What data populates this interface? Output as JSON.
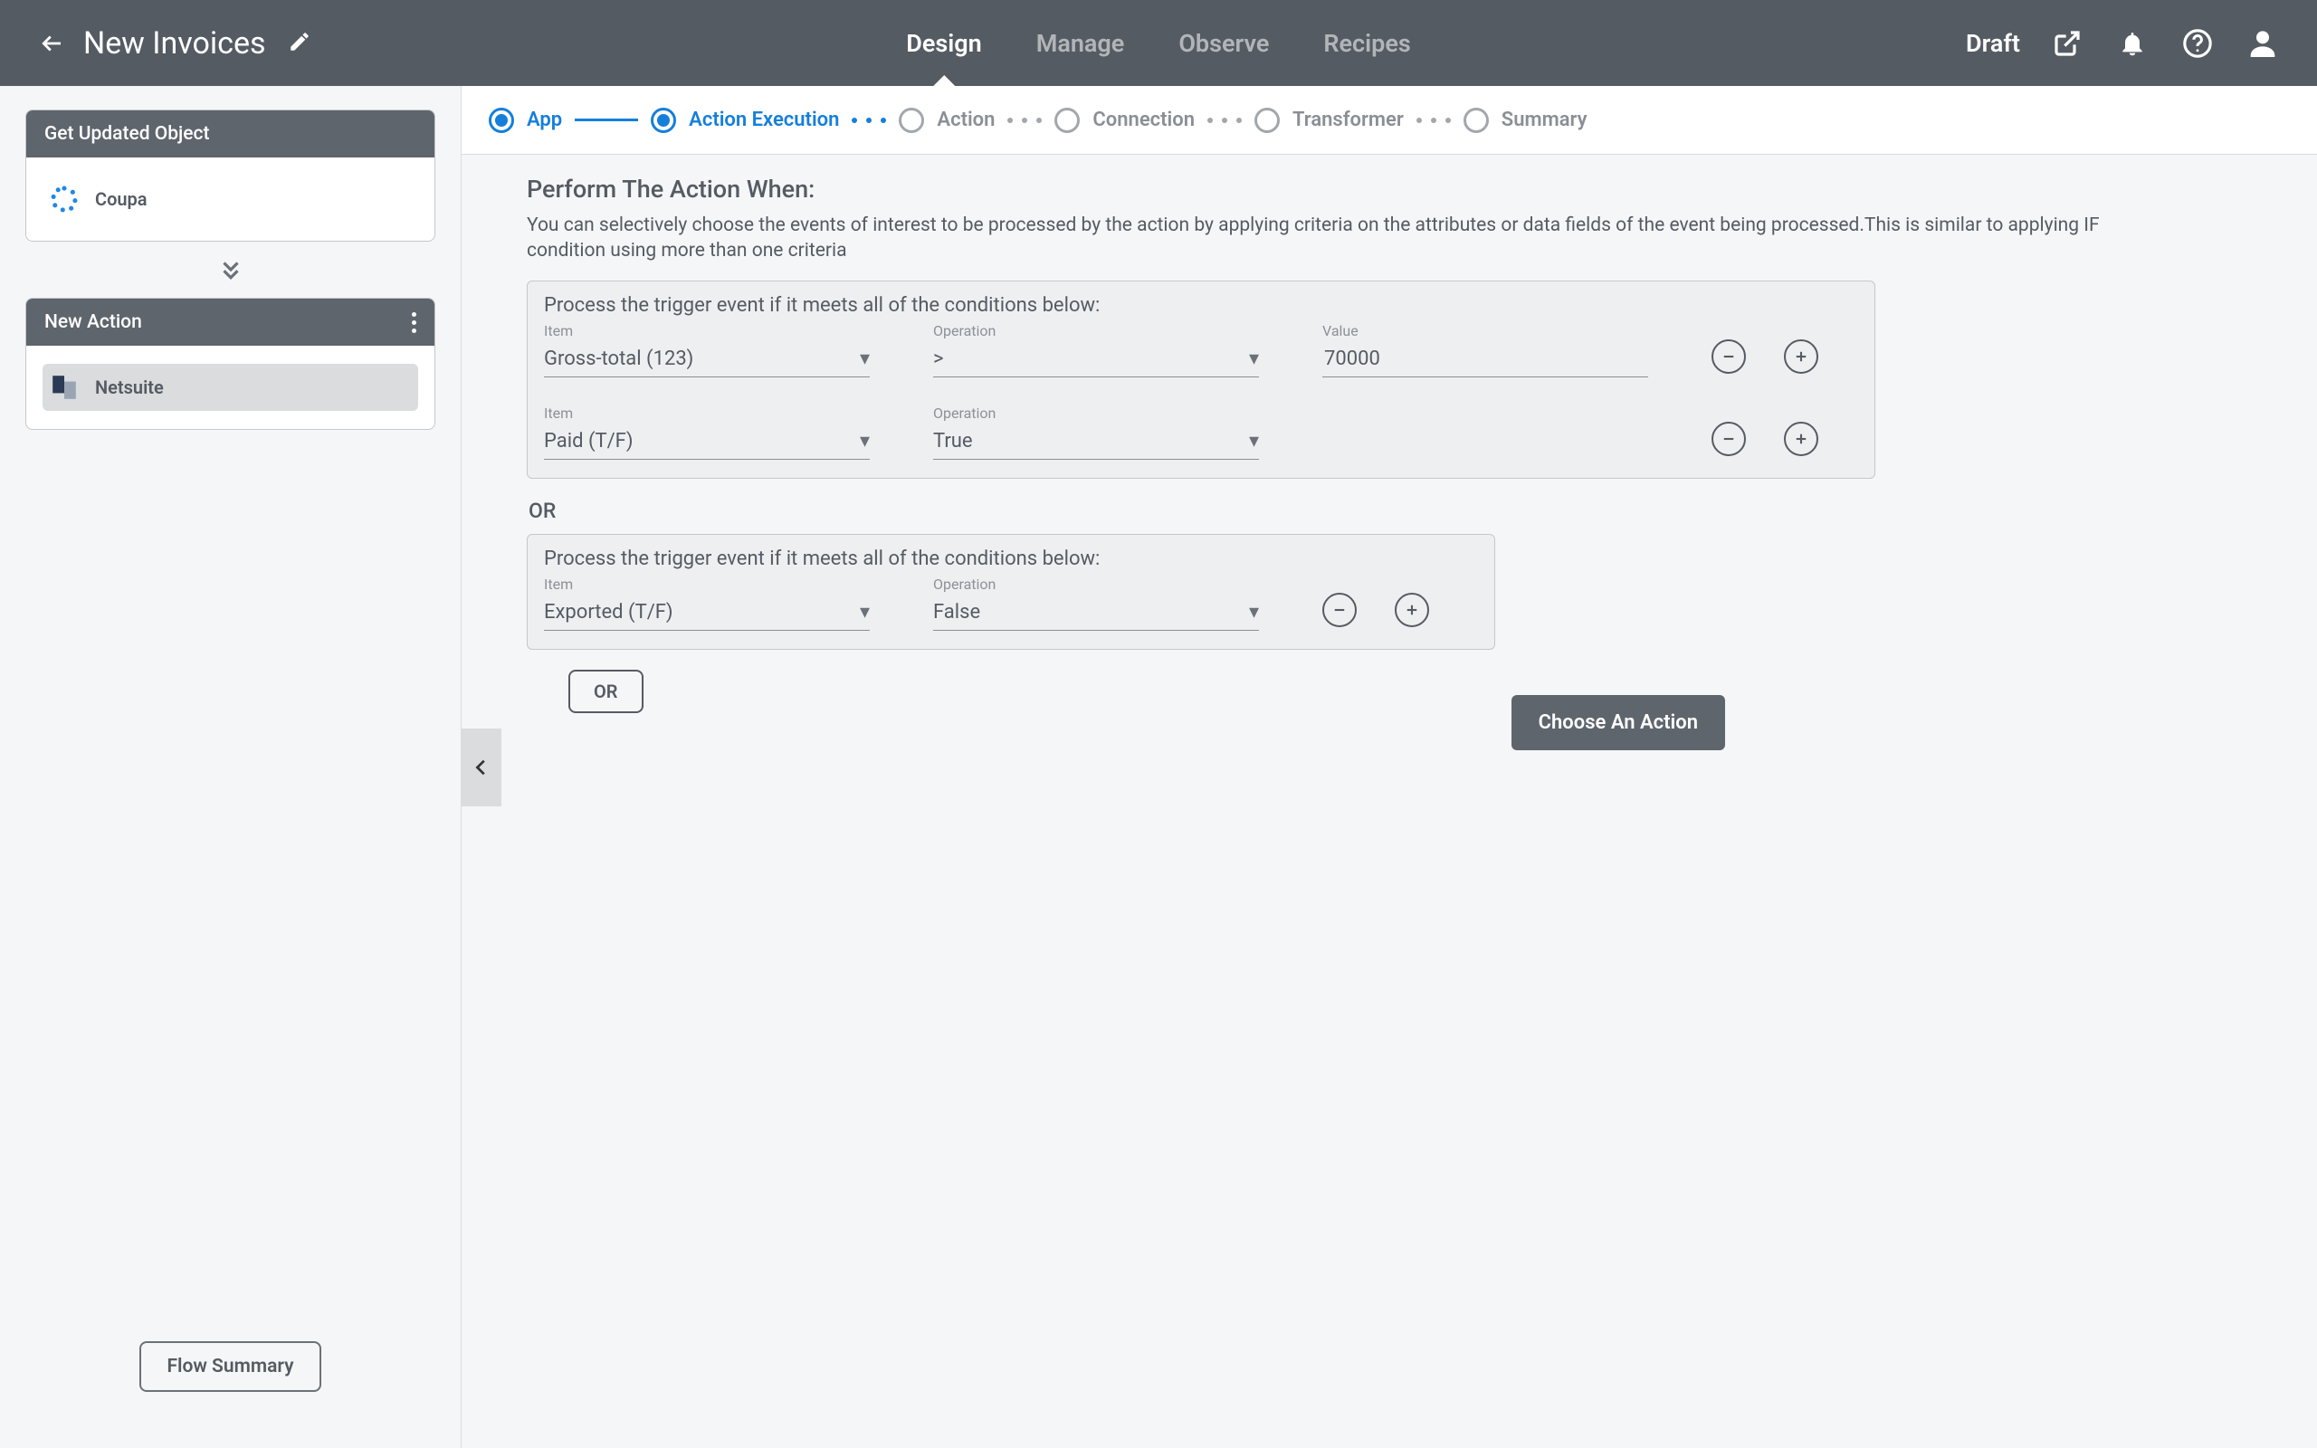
{
  "header": {
    "title": "New Invoices",
    "status": "Draft",
    "nav": {
      "design": "Design",
      "manage": "Manage",
      "observe": "Observe",
      "recipes": "Recipes"
    }
  },
  "sidebar": {
    "source": {
      "header": "Get Updated Object",
      "app": "Coupa"
    },
    "target": {
      "header": "New Action",
      "app": "Netsuite"
    },
    "flow_summary": "Flow Summary"
  },
  "stepper": {
    "app": "App",
    "action_execution": "Action Execution",
    "action": "Action",
    "connection": "Connection",
    "transformer": "Transformer",
    "summary": "Summary"
  },
  "section": {
    "title": "Perform The Action When:",
    "desc": "You can selectively choose the events of interest to be processed by the action by applying criteria on the attributes or data fields of the event being processed.This is similar to applying IF condition using more than one criteria"
  },
  "labels": {
    "item": "Item",
    "operation": "Operation",
    "value": "Value",
    "block_title": "Process the trigger event if it meets all of the conditions below:",
    "or": "OR",
    "or_pill": "OR",
    "choose_action": "Choose An Action"
  },
  "blocks": [
    {
      "rows": [
        {
          "item": "Gross-total (123)",
          "operation": ">",
          "value": "70000",
          "has_value": true
        },
        {
          "item": "Paid (T/F)",
          "operation": "True",
          "has_value": false
        }
      ]
    },
    {
      "rows": [
        {
          "item": "Exported (T/F)",
          "operation": "False",
          "has_value": false
        }
      ]
    }
  ]
}
